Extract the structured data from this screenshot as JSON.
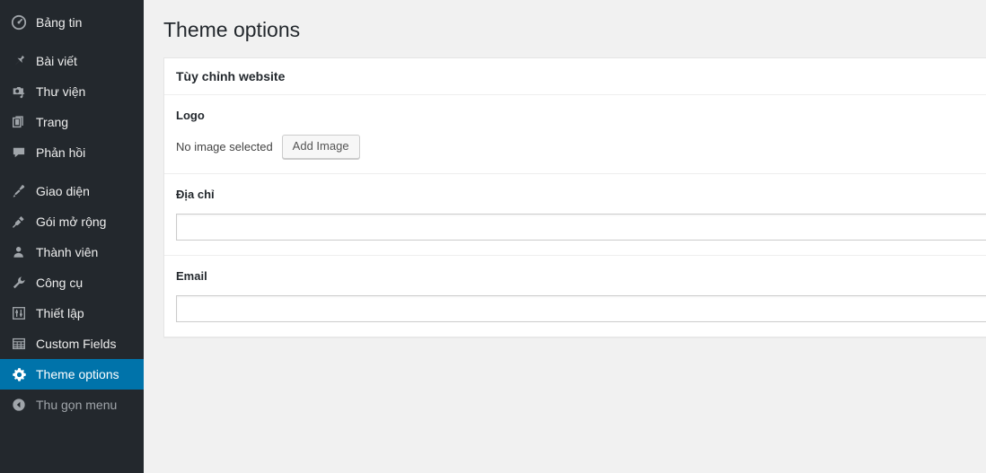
{
  "colors": {
    "sidebar_bg": "#23282d",
    "active_blue": "#0073aa",
    "page_bg": "#f1f1f1",
    "panel_bg": "#ffffff"
  },
  "sidebar": {
    "items": [
      {
        "label": "Bảng tin",
        "icon": "dashboard-icon",
        "state": "normal"
      },
      {
        "label": "Bài viết",
        "icon": "pushpin-icon",
        "state": "normal"
      },
      {
        "label": "Thư viện",
        "icon": "media-icon",
        "state": "normal"
      },
      {
        "label": "Trang",
        "icon": "pages-icon",
        "state": "normal"
      },
      {
        "label": "Phản hồi",
        "icon": "comment-icon",
        "state": "normal"
      },
      {
        "label": "Giao diện",
        "icon": "paintbrush-icon",
        "state": "normal"
      },
      {
        "label": "Gói mở rộng",
        "icon": "plugin-plug-icon",
        "state": "normal"
      },
      {
        "label": "Thành viên",
        "icon": "user-icon",
        "state": "normal"
      },
      {
        "label": "Công cụ",
        "icon": "wrench-icon",
        "state": "normal"
      },
      {
        "label": "Thiết lập",
        "icon": "sliders-icon",
        "state": "normal"
      },
      {
        "label": "Custom Fields",
        "icon": "table-grid-icon",
        "state": "normal"
      },
      {
        "label": "Theme options",
        "icon": "gear-icon",
        "state": "active"
      },
      {
        "label": "Thu gọn menu",
        "icon": "collapse-left-icon",
        "state": "dim"
      }
    ]
  },
  "main": {
    "page_title": "Theme options",
    "panel": {
      "header": "Tùy chỉnh website",
      "logo": {
        "label": "Logo",
        "status_text": "No image selected",
        "button_label": "Add Image"
      },
      "address": {
        "label": "Địa chỉ",
        "value": "",
        "placeholder": ""
      },
      "email": {
        "label": "Email",
        "value": "",
        "placeholder": ""
      }
    }
  }
}
